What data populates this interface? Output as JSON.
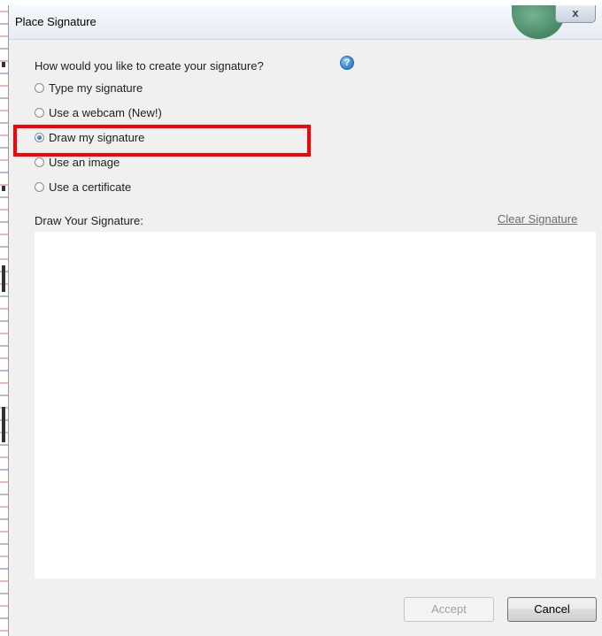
{
  "window": {
    "title": "Place Signature",
    "close_glyph": "x"
  },
  "prompt": {
    "question": "How would you like to create your signature?",
    "help_glyph": "?"
  },
  "options": [
    {
      "label": "Type my signature",
      "checked": false
    },
    {
      "label": "Use a webcam (New!)",
      "checked": false
    },
    {
      "label": "Draw my signature",
      "checked": true
    },
    {
      "label": "Use an image",
      "checked": false
    },
    {
      "label": "Use a certificate",
      "checked": false
    }
  ],
  "draw_area": {
    "label": "Draw Your Signature:",
    "clear_link": "Clear Signature"
  },
  "buttons": {
    "accept": "Accept",
    "cancel": "Cancel"
  },
  "colors": {
    "highlight": "#ff0000",
    "dialog_background": "#f0f0f0",
    "canvas_background": "#ffffff"
  }
}
